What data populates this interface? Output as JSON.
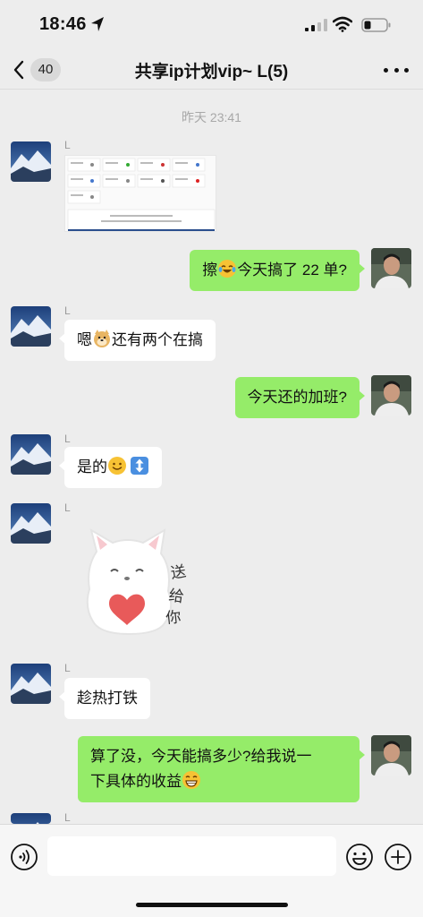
{
  "status_bar": {
    "time": "18:46"
  },
  "nav": {
    "back_count": "40",
    "title": "共享ip计划vip~ L(5)"
  },
  "timestamp": "昨天 23:41",
  "messages": [
    {
      "side": "in",
      "name": "L",
      "type": "image"
    },
    {
      "side": "out",
      "pre": "擦",
      "emoji": "laughing-crying",
      "post": "今天搞了 22 单?"
    },
    {
      "side": "in",
      "name": "L",
      "pre": "嗯",
      "emoji": "doge",
      "post": "还有两个在搞"
    },
    {
      "side": "out",
      "text": "今天还的加班?"
    },
    {
      "side": "in",
      "name": "L",
      "pre": "是的",
      "emoji": "smile",
      "emoji2": "up-down-arrow"
    },
    {
      "side": "in",
      "name": "L",
      "type": "sticker",
      "sticker_text": "送给你"
    },
    {
      "side": "in",
      "name": "L",
      "text": "趁热打铁"
    },
    {
      "side": "out",
      "line1": "算了没，今天能搞多少?给我说一",
      "line2": "下具体的收益",
      "emoji": "grin"
    },
    {
      "side": "in",
      "name": "L"
    }
  ],
  "input": {
    "placeholder": ""
  },
  "colors": {
    "background": "#ededed",
    "bubble_out": "#95ec69",
    "bubble_in": "#ffffff"
  }
}
